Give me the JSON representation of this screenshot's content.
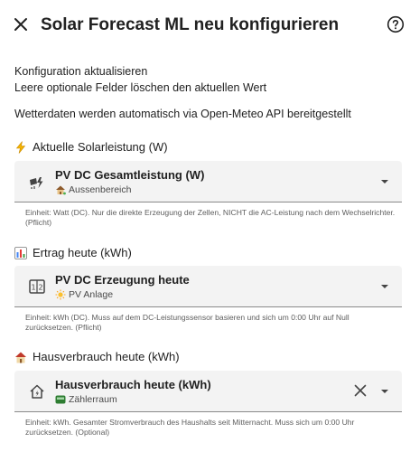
{
  "dialog": {
    "title": "Solar Forecast ML neu konfigurieren",
    "close_icon": "close-icon",
    "help_icon": "help-circle-icon"
  },
  "intro": {
    "line1": "Konfiguration aktualisieren",
    "line2": "Leere optionale Felder löschen den aktuellen Wert",
    "line3": "Wetterdaten werden automatisch via Open-Meteo API bereitgestellt"
  },
  "fields": [
    {
      "label": "Aktuelle Solarleistung (W)",
      "label_icon": "lightning-icon",
      "entity_name": "PV DC Gesamtleistung (W)",
      "entity_icon": "solar-power-icon",
      "area": "Aussenbereich",
      "area_icon": "house-garden-icon",
      "helper": "Einheit: Watt (DC). Nur die direkte Erzeugung der Zellen, NICHT die AC-Leistung nach dem Wechselrichter. (Pflicht)"
    },
    {
      "label": "Ertrag heute (kWh)",
      "label_icon": "bar-chart-icon",
      "entity_name": "PV DC Erzeugung heute",
      "entity_icon": "counter-icon",
      "area": "PV Anlage",
      "area_icon": "sun-icon",
      "helper": "Einheit: kWh (DC). Muss auf dem DC-Leistungssensor basieren und sich um 0:00 Uhr auf Null zurücksetzen. (Pflicht)"
    },
    {
      "label": "Hausverbrauch heute (kWh)",
      "label_icon": "house-icon",
      "entity_name": "Hausverbrauch heute (kWh)",
      "entity_icon": "home-lightning-icon",
      "area": "Zählerraum",
      "area_icon": "meter-icon",
      "helper": "Einheit: kWh. Gesamter Stromverbrauch des Haushalts seit Mitternacht. Muss sich um 0:00 Uhr zurücksetzen. (Optional)"
    }
  ],
  "colors": {
    "picker_bg": "#f3f3f3",
    "underline": "#8a8a8a",
    "helper_text": "#5e5e5e"
  }
}
